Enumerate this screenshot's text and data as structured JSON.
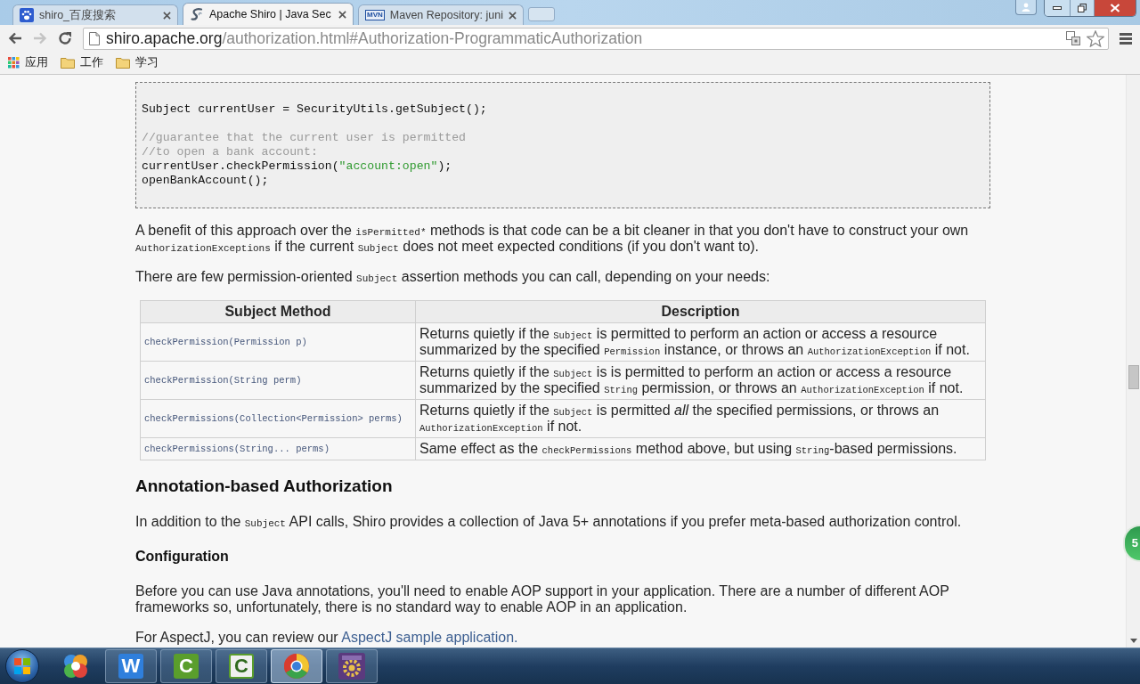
{
  "browser": {
    "tabs": [
      {
        "title": "shiro_百度搜索",
        "favicon": {
          "kind": "paw"
        },
        "selected": false
      },
      {
        "title": "Apache Shiro | Java Sec",
        "favicon": {
          "kind": "swirl"
        },
        "selected": true
      },
      {
        "title": "Maven Repository: juni",
        "favicon": {
          "kind": "text",
          "text": "MVN"
        },
        "selected": false
      }
    ],
    "forward": {
      "disabled": true
    },
    "address": {
      "host": "shiro.apache.org",
      "path": "/authorization.html#Authorization-ProgrammaticAuthorization"
    },
    "bookmarks": [
      {
        "label": "应用",
        "kind": "apps"
      },
      {
        "label": "工作",
        "kind": "folder"
      },
      {
        "label": "学习",
        "kind": "folder"
      }
    ]
  },
  "page": {
    "code": {
      "groups": [
        {
          "lines": [
            [
              {
                "kind": "plain",
                "text": "Subject currentUser = SecurityUtils.getSubject();"
              }
            ]
          ]
        },
        {
          "lines": [
            [
              {
                "kind": "comment",
                "text": "//guarantee that the current user is permitted"
              }
            ],
            [
              {
                "kind": "comment",
                "text": "//to open a bank account:"
              }
            ],
            [
              {
                "kind": "plain",
                "text": "currentUser.checkPermission("
              },
              {
                "kind": "string",
                "text": "\"account:open\""
              },
              {
                "kind": "plain",
                "text": ");"
              }
            ],
            [
              {
                "kind": "plain",
                "text": "openBankAccount();"
              }
            ]
          ]
        }
      ]
    },
    "blocks": [
      {
        "kind": "paragraph",
        "segments": [
          {
            "kind": "text",
            "text": "A benefit of this approach over the "
          },
          {
            "kind": "code",
            "text": "isPermitted*"
          },
          {
            "kind": "text",
            "text": " methods is that code can be a bit cleaner in that you don't have to construct your own "
          },
          {
            "kind": "code",
            "text": "AuthorizationExceptions"
          },
          {
            "kind": "text",
            "text": " if the current "
          },
          {
            "kind": "code",
            "text": "Subject"
          },
          {
            "kind": "text",
            "text": " does not meet expected conditions (if you don't want to)."
          }
        ]
      },
      {
        "kind": "paragraph",
        "segments": [
          {
            "kind": "text",
            "text": "There are few permission-oriented "
          },
          {
            "kind": "code",
            "text": "Subject"
          },
          {
            "kind": "text",
            "text": " assertion methods you can call, depending on your needs:"
          }
        ]
      },
      {
        "kind": "table",
        "columns": [
          "Subject Method",
          "Description"
        ],
        "rows": [
          {
            "method": "checkPermission(Permission p)",
            "description": [
              {
                "kind": "text",
                "text": "Returns quietly if the "
              },
              {
                "kind": "code",
                "text": "Subject"
              },
              {
                "kind": "text",
                "text": " is permitted to perform an action or access a resource summarized by the specified "
              },
              {
                "kind": "code",
                "text": "Permission"
              },
              {
                "kind": "text",
                "text": " instance, or throws an "
              },
              {
                "kind": "code",
                "text": "AuthorizationException"
              },
              {
                "kind": "text",
                "text": " if not."
              }
            ]
          },
          {
            "method": "checkPermission(String perm)",
            "description": [
              {
                "kind": "text",
                "text": "Returns quietly if the "
              },
              {
                "kind": "code",
                "text": "Subject"
              },
              {
                "kind": "text",
                "text": " is is permitted to perform an action or access a resource summarized by the specified "
              },
              {
                "kind": "code",
                "text": "String"
              },
              {
                "kind": "text",
                "text": " permission, or throws an "
              },
              {
                "kind": "code",
                "text": "AuthorizationException"
              },
              {
                "kind": "text",
                "text": " if not."
              }
            ]
          },
          {
            "method": "checkPermissions(Collection<Permission> perms)",
            "description": [
              {
                "kind": "text",
                "text": "Returns quietly if the "
              },
              {
                "kind": "code",
                "text": "Subject"
              },
              {
                "kind": "text",
                "text": " is permitted *all* the specified permissions, or throws an "
              },
              {
                "kind": "code",
                "text": "AuthorizationException"
              },
              {
                "kind": "text",
                "text": " if not."
              }
            ]
          },
          {
            "method": "checkPermissions(String... perms)",
            "description": [
              {
                "kind": "text",
                "text": "Same effect as the "
              },
              {
                "kind": "code",
                "text": "checkPermissions"
              },
              {
                "kind": "text",
                "text": " method above, but using "
              },
              {
                "kind": "code",
                "text": "String"
              },
              {
                "kind": "text",
                "text": "-based permissions."
              }
            ]
          }
        ]
      },
      {
        "kind": "heading",
        "text": "Annotation-based Authorization"
      },
      {
        "kind": "paragraph",
        "segments": [
          {
            "kind": "text",
            "text": "In addition to the "
          },
          {
            "kind": "code",
            "text": "Subject"
          },
          {
            "kind": "text",
            "text": " API calls, Shiro provides a collection of Java 5+ annotations if you prefer meta-based authorization control."
          }
        ]
      },
      {
        "kind": "subheading",
        "text": "Configuration"
      },
      {
        "kind": "paragraph",
        "segments": [
          {
            "kind": "text",
            "text": "Before you can use Java annotations, you'll need to enable AOP support in your application. There are a number of different AOP frameworks so, unfortunately, there is no standard way to enable AOP in an application."
          }
        ]
      },
      {
        "kind": "paragraph",
        "segments": [
          {
            "kind": "text",
            "text": "For AspectJ, you can review our "
          },
          {
            "kind": "link",
            "text": "AspectJ sample application."
          }
        ]
      }
    ],
    "floating_widget": {
      "text": "5"
    }
  },
  "taskbar": {
    "items": [
      {
        "kind": "petals",
        "running": false,
        "selected": false
      },
      {
        "kind": "letter_tile",
        "glyph": "W",
        "color": "#2f7fdc",
        "running": true,
        "selected": false
      },
      {
        "kind": "letter_tile",
        "glyph": "C",
        "color": "#5a9e2c",
        "running": true,
        "selected": false
      },
      {
        "kind": "letter_tile",
        "glyph": "C",
        "color": "#f0f0f0",
        "running": true,
        "selected": false
      },
      {
        "kind": "ball",
        "running": true,
        "selected": true
      },
      {
        "kind": "gear_tile",
        "running": true,
        "selected": false
      }
    ]
  }
}
